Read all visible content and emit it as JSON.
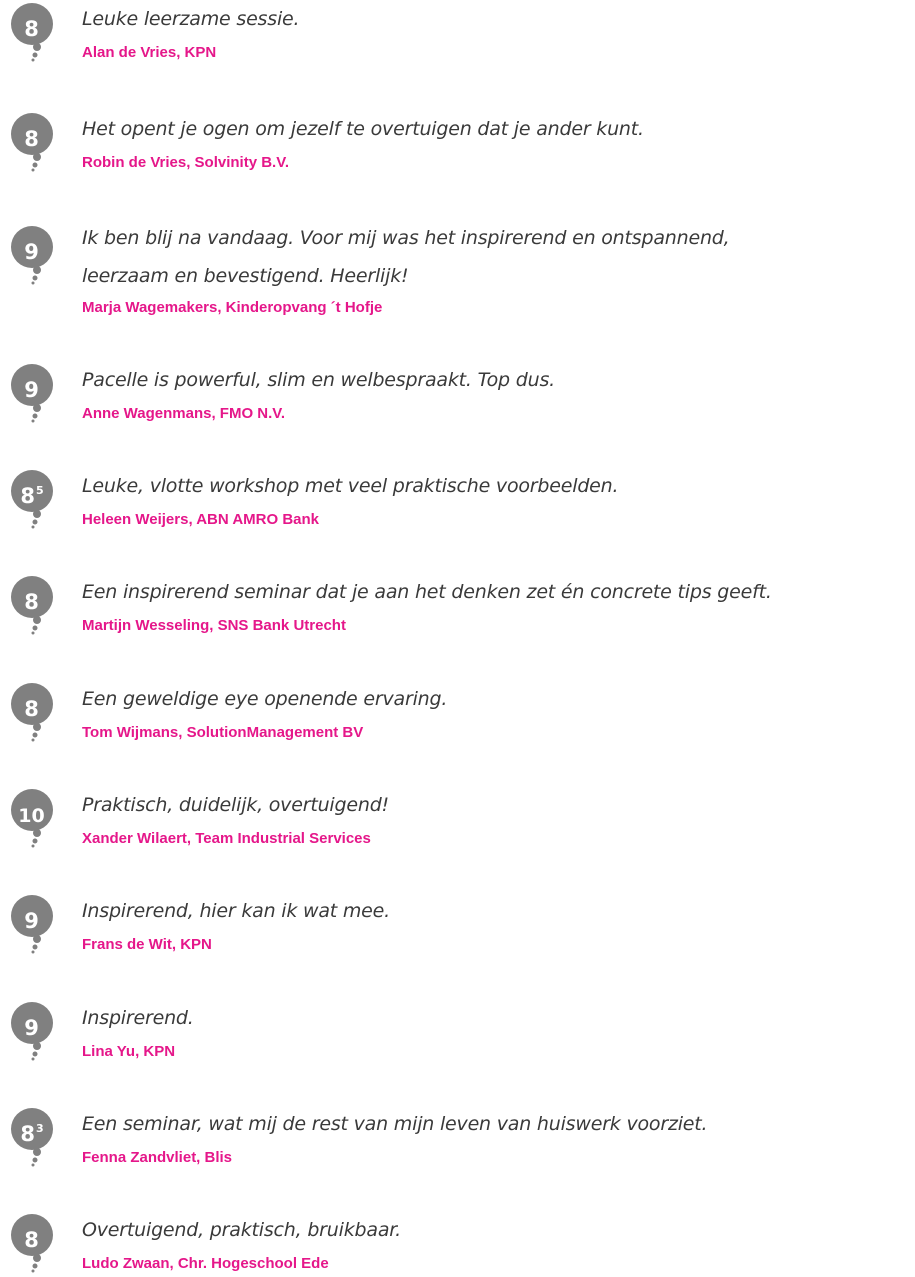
{
  "colors": {
    "badge": "#808080",
    "quote_text": "#3a3a3a",
    "author_text": "#e5178a"
  },
  "badge_icon": "speech-bubble-icon",
  "testimonials": [
    {
      "score": "8",
      "score_sup": "",
      "quote": [
        "Leuke leerzame sessie."
      ],
      "author": "Alan de Vries, KPN"
    },
    {
      "score": "8",
      "score_sup": "",
      "quote": [
        "Het opent je ogen om jezelf te overtuigen dat je ander kunt."
      ],
      "author": "Robin de Vries, Solvinity B.V."
    },
    {
      "score": "9",
      "score_sup": "",
      "quote": [
        "Ik ben blij na vandaag. Voor mij was het inspirerend en ontspannend,",
        "leerzaam en bevestigend. Heerlijk!"
      ],
      "author": "Marja Wagemakers, Kinderopvang ´t Hofje"
    },
    {
      "score": "9",
      "score_sup": "",
      "quote": [
        "Pacelle is powerful, slim en welbespraakt. Top dus."
      ],
      "author": "Anne Wagenmans, FMO N.V."
    },
    {
      "score": "8",
      "score_sup": "5",
      "quote": [
        "Leuke, vlotte workshop met veel praktische voorbeelden."
      ],
      "author": "Heleen Weijers, ABN AMRO Bank"
    },
    {
      "score": "8",
      "score_sup": "",
      "quote": [
        "Een inspirerend seminar dat je aan het denken zet én concrete tips geeft."
      ],
      "author": "Martijn Wesseling, SNS Bank Utrecht"
    },
    {
      "score": "8",
      "score_sup": "",
      "quote": [
        "Een geweldige eye openende ervaring."
      ],
      "author": "Tom Wijmans, SolutionManagement BV"
    },
    {
      "score": "10",
      "score_sup": "",
      "quote": [
        "Praktisch, duidelijk, overtuigend!"
      ],
      "author": "Xander Wilaert, Team Industrial Services"
    },
    {
      "score": "9",
      "score_sup": "",
      "quote": [
        "Inspirerend, hier kan ik wat mee."
      ],
      "author": "Frans de Wit, KPN"
    },
    {
      "score": "9",
      "score_sup": "",
      "quote": [
        "Inspirerend."
      ],
      "author": "Lina Yu, KPN"
    },
    {
      "score": "8",
      "score_sup": "3",
      "quote": [
        "Een seminar, wat mij de rest van mijn leven van huiswerk voorziet."
      ],
      "author": "Fenna Zandvliet, Blis"
    },
    {
      "score": "8",
      "score_sup": "",
      "quote": [
        "Overtuigend, praktisch, bruikbaar."
      ],
      "author": "Ludo Zwaan, Chr. Hogeschool Ede"
    }
  ]
}
